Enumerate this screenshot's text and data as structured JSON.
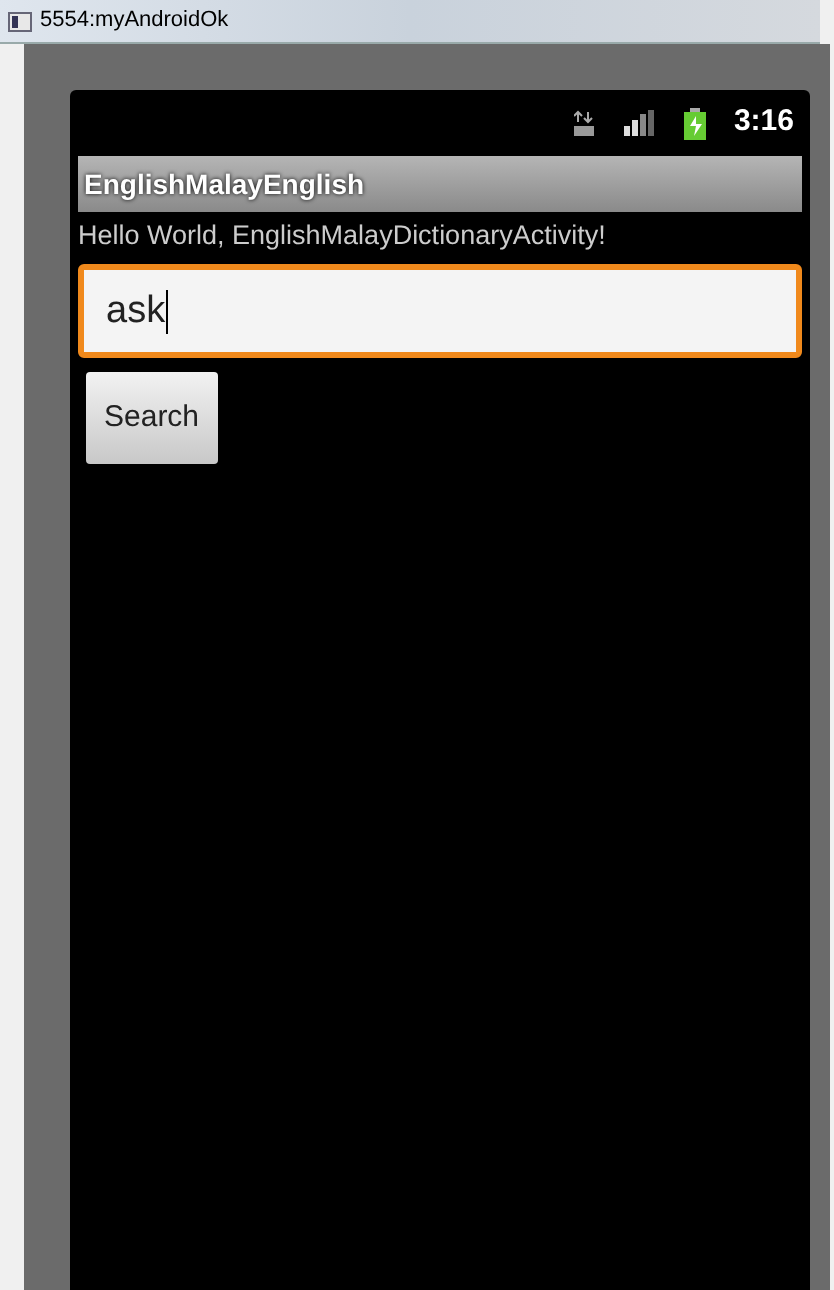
{
  "window": {
    "title": "5554:myAndroidOk"
  },
  "status_bar": {
    "time": "3:16"
  },
  "app": {
    "title": "EnglishMalayEnglish",
    "greeting": "Hello World, EnglishMalayDictionaryActivity!"
  },
  "search": {
    "value": "ask",
    "focused": true
  },
  "buttons": [
    "Search"
  ]
}
